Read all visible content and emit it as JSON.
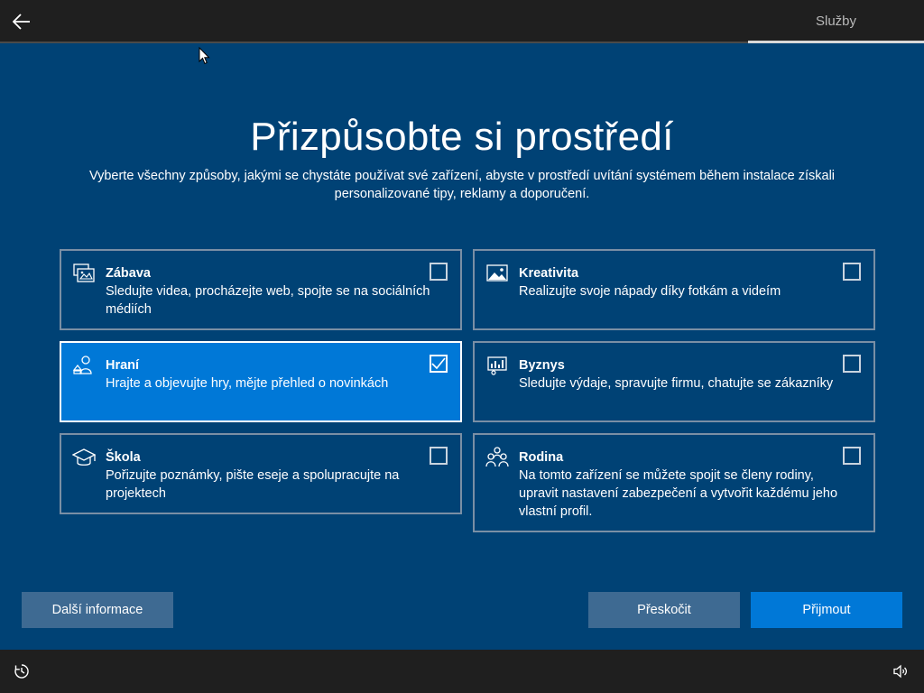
{
  "header": {
    "stage_label": "Služby"
  },
  "main": {
    "title": "Přizpůsobte si prostředí",
    "subtitle": "Vyberte všechny způsoby, jakými se chystáte používat své zařízení, abyste v prostředí uvítání systémem během instalace získali personalizované tipy, reklamy a doporučení."
  },
  "options": [
    {
      "title": "Zábava",
      "desc": "Sledujte videa, procházejte web, spojte se na sociálních médiích",
      "checked": false,
      "icon": "entertainment-icon"
    },
    {
      "title": "Kreativita",
      "desc": "Realizujte svoje nápady díky fotkám a videím",
      "checked": false,
      "icon": "image-icon"
    },
    {
      "title": "Hraní",
      "desc": "Hrajte a objevujte hry, mějte přehled o novinkách",
      "checked": true,
      "icon": "gaming-icon"
    },
    {
      "title": "Byznys",
      "desc": "Sledujte výdaje, spravujte firmu, chatujte se zákazníky",
      "checked": false,
      "icon": "business-chart-icon"
    },
    {
      "title": "Škola",
      "desc": "Pořizujte poznámky, pište eseje a spolupracujte na projektech",
      "checked": false,
      "icon": "graduation-cap-icon"
    },
    {
      "title": "Rodina",
      "desc": "Na tomto zařízení se můžete spojit se členy rodiny, upravit nastavení zabezpečení a vytvořit každému jeho vlastní profil.",
      "checked": false,
      "icon": "family-icon"
    }
  ],
  "buttons": {
    "more_info": "Další informace",
    "skip": "Přeskočit",
    "accept": "Přijmout"
  },
  "colors": {
    "background": "#004275",
    "accent": "#0078d7",
    "secondary_button": "#3e6a92",
    "bar": "#1f1f1f"
  },
  "icons": {
    "back": "back-arrow-icon",
    "accessibility": "accessibility-icon",
    "volume": "volume-icon"
  }
}
